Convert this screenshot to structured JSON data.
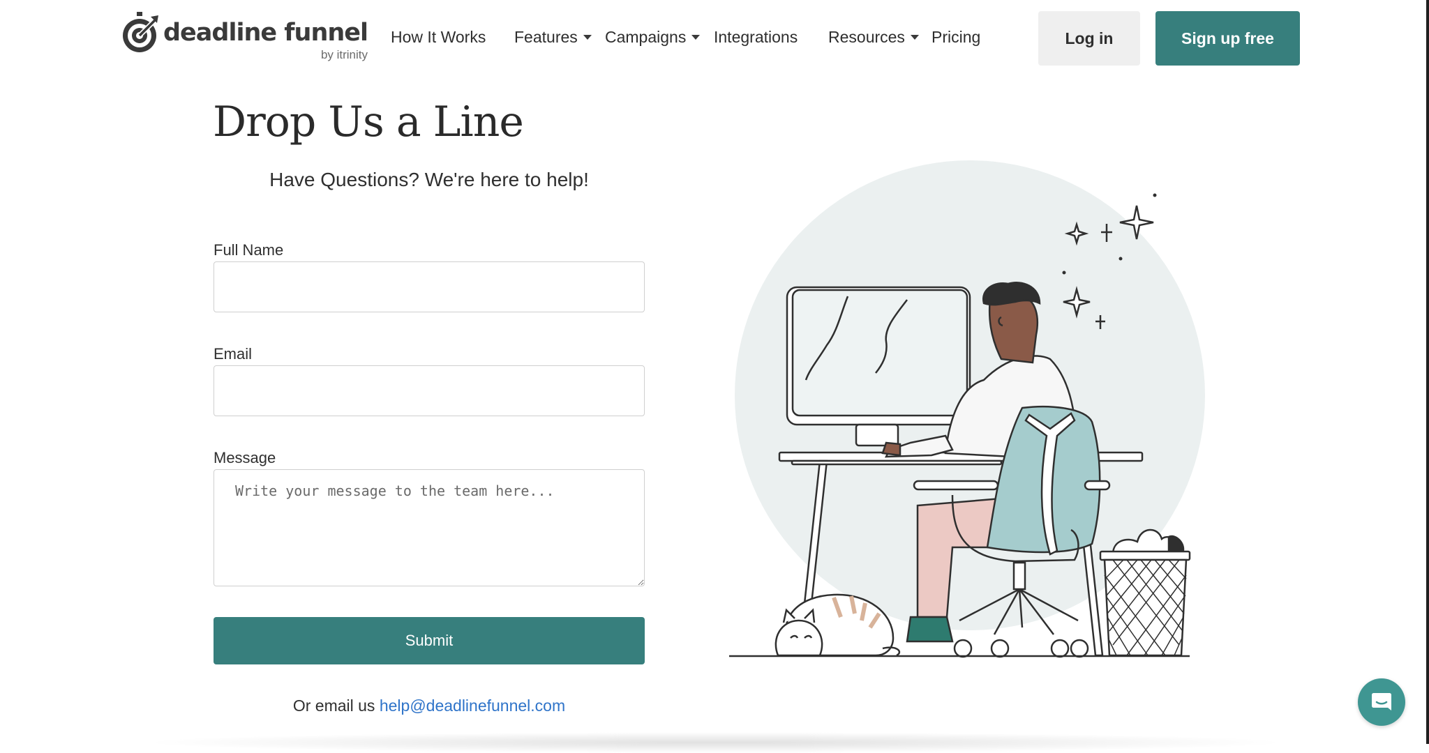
{
  "brand": {
    "name": "deadline funnel",
    "sub": "by itrinity",
    "logo_icon": "stopwatch-target-icon"
  },
  "nav": [
    {
      "label": "How It Works",
      "dropdown": false
    },
    {
      "label": "Features",
      "dropdown": true
    },
    {
      "label": "Campaigns",
      "dropdown": true
    },
    {
      "label": "Integrations",
      "dropdown": false
    },
    {
      "label": "Resources",
      "dropdown": true
    },
    {
      "label": "Pricing",
      "dropdown": false
    }
  ],
  "header_buttons": {
    "login": "Log in",
    "signup": "Sign up free"
  },
  "form": {
    "title": "Drop Us a Line",
    "subtitle": "Have Questions? We're here to help!",
    "full_name": {
      "label": "Full Name",
      "value": "",
      "placeholder": ""
    },
    "email": {
      "label": "Email",
      "value": "",
      "placeholder": ""
    },
    "message": {
      "label": "Message",
      "value": "",
      "placeholder": "Write your message to the team here..."
    },
    "submit": "Submit"
  },
  "contact": {
    "prefix": "Or email us",
    "email": "help@deadlinefunnel.com"
  },
  "chat_widget": {
    "icon": "chat-bubble-icon"
  },
  "colors": {
    "accent": "#377f7d",
    "link": "#2f74c9",
    "login_bg": "#efefef",
    "illustration_bg": "#ebf0f0",
    "chair": "#a5cccd",
    "pants": "#ecc9c4",
    "skin": "#8a5a48",
    "shoes": "#2e7b6f"
  }
}
